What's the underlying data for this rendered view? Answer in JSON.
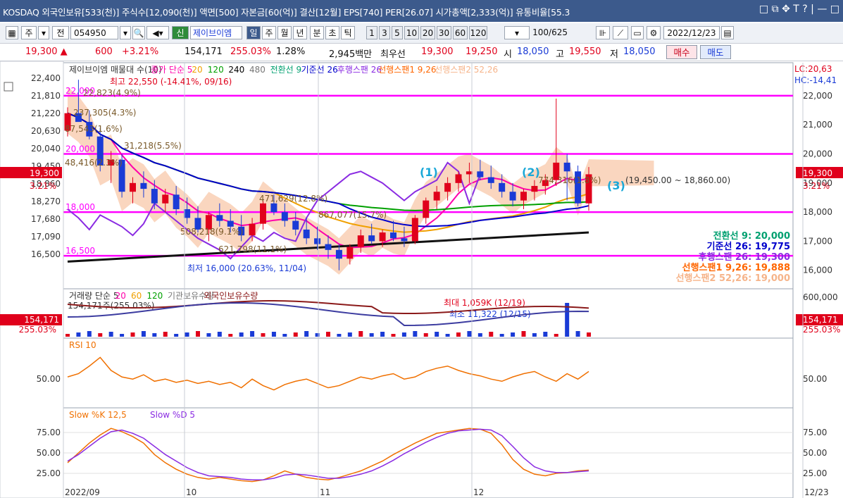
{
  "titlebar": {
    "text": "KOSDAQ 외국인보유[533(천)] 주식수[12,090(천)] 액면[500] 자본금[60(억)] 결산[12월] EPS[740] PER[26.07] 시가총액[2,333(억)] 유통비율[55.3",
    "controls": "□ ⧉ ✥ T ? | — □"
  },
  "toolbar": {
    "period_main": "주",
    "period_prev": "전",
    "code": "054950",
    "stock_name": "제이브이엠",
    "period_day": "일",
    "period_week": "주",
    "period_month": "월",
    "period_year": "년",
    "period_min": "분",
    "period_sec": "초",
    "period_tick": "틱",
    "intervals": [
      "1",
      "3",
      "5",
      "10",
      "20",
      "30",
      "60",
      "120"
    ],
    "count": "100",
    "count_total": "/625",
    "date": "2022/12/23"
  },
  "quote": {
    "price": "19,300",
    "change": "600",
    "change_pct": "+3.21%",
    "volume": "154,171",
    "vol_ratio": "255.03%",
    "turnover": "1.28%",
    "amount": "2,945백만",
    "best_label": "최우선",
    "ask": "19,300",
    "bid": "19,250",
    "open_label": "시",
    "open": "18,050",
    "high_label": "고",
    "high": "19,550",
    "low_label": "저",
    "low": "18,050",
    "buy_label": "매수",
    "sell_label": "매도"
  },
  "chart_data": [
    {
      "type": "candlestick",
      "legend_text": [
        "제이브이엠 매물대 수(10)",
        "종가 단순 5",
        "20",
        "120",
        "240",
        "480",
        "전환선 9",
        "기준선 26",
        "후행스팬 26",
        "선행스팬1 9,26",
        "선행스팬2 52,26"
      ],
      "ylim": [
        15800,
        22700
      ],
      "yticks_left": [
        "22,400",
        "21,810",
        "21,220",
        "20,630",
        "20,040",
        "19,450",
        "18,860",
        "18,270",
        "17,680",
        "17,090",
        "16,500"
      ],
      "yticks_right": [
        "22,000",
        "21,000",
        "20,000",
        "19,000",
        "18,000",
        "17,000",
        "16,000"
      ],
      "top_right": [
        "LC:20,63",
        "HC:-14,41"
      ],
      "current_price": "19,300",
      "current_pct": "3.21%",
      "hlines": [
        {
          "label": "22,000",
          "value": 22000
        },
        {
          "label": "20,000",
          "value": 20000
        },
        {
          "label": "18,000",
          "value": 18000
        },
        {
          "label": "16,500",
          "value": 16500
        }
      ],
      "annotations": [
        "최고 22,550 (-14.41%, 09/16)",
        "최저 16,000 (20.63%, 11/04)",
        "(1)",
        "(2)",
        "(3)",
        "(19,450.00 ~ 18,860.00)"
      ],
      "volume_profile": [
        "237,305(4.3%)",
        "87,543(1.6%)",
        "48,416(2.3%)",
        "471,629(12.8%)",
        "867,077(15.7%)",
        "508,218(9.1%)",
        "621,798(11.1%)",
        "774,316(1.8%)",
        "22,823(4.9%)",
        "31,218(5.5%)"
      ],
      "indicators": [
        {
          "name": "전환선 9",
          "value": "20,000"
        },
        {
          "name": "기준선 26",
          "value": "19,775"
        },
        {
          "name": "후행스팬 26",
          "value": "19,300"
        },
        {
          "name": "선행스팬1 9,26",
          "value": "19,888"
        },
        {
          "name": "선행스팬2 52,26",
          "value": "19,000"
        }
      ],
      "candles": [
        [
          20800,
          21600,
          20600,
          21400
        ],
        [
          21400,
          22550,
          21200,
          21100
        ],
        [
          21100,
          21500,
          20500,
          20600
        ],
        [
          20600,
          20900,
          19400,
          19600
        ],
        [
          19600,
          20100,
          19000,
          19800
        ],
        [
          19800,
          20000,
          18500,
          18700
        ],
        [
          18700,
          19200,
          18300,
          19000
        ],
        [
          19000,
          19400,
          18500,
          18800
        ],
        [
          18800,
          19100,
          18100,
          18300
        ],
        [
          18300,
          18800,
          18000,
          18600
        ],
        [
          18600,
          18900,
          17900,
          18100
        ],
        [
          18100,
          18500,
          17600,
          17800
        ],
        [
          17800,
          18200,
          17300,
          17400
        ],
        [
          17400,
          18000,
          17000,
          17900
        ],
        [
          17900,
          18300,
          17500,
          17700
        ],
        [
          17700,
          18100,
          17300,
          17500
        ],
        [
          17500,
          17900,
          17000,
          17200
        ],
        [
          17200,
          17800,
          17000,
          17600
        ],
        [
          17600,
          18400,
          17400,
          18300
        ],
        [
          18300,
          18600,
          17900,
          18000
        ],
        [
          18000,
          18300,
          17500,
          17700
        ],
        [
          17700,
          18000,
          17200,
          17400
        ],
        [
          17400,
          17800,
          16900,
          17100
        ],
        [
          17100,
          17500,
          16700,
          16900
        ],
        [
          16900,
          17200,
          16400,
          16700
        ],
        [
          16700,
          16900,
          16000,
          16400
        ],
        [
          16400,
          16900,
          16200,
          16800
        ],
        [
          16800,
          17400,
          16600,
          17200
        ],
        [
          17200,
          17600,
          16900,
          17000
        ],
        [
          17000,
          17400,
          16800,
          17300
        ],
        [
          17300,
          17700,
          17000,
          17100
        ],
        [
          17100,
          17500,
          16800,
          17000
        ],
        [
          17000,
          17900,
          16900,
          17800
        ],
        [
          17800,
          18500,
          17600,
          18400
        ],
        [
          18400,
          18900,
          18100,
          18700
        ],
        [
          18700,
          19200,
          18400,
          19000
        ],
        [
          19000,
          19400,
          18700,
          19300
        ],
        [
          19300,
          19700,
          19000,
          19400
        ],
        [
          19400,
          19800,
          19100,
          19200
        ],
        [
          19200,
          19600,
          18800,
          19000
        ],
        [
          19000,
          19300,
          18500,
          18700
        ],
        [
          18700,
          19000,
          18200,
          18400
        ],
        [
          18400,
          18800,
          18100,
          18700
        ],
        [
          18700,
          19100,
          18400,
          18900
        ],
        [
          18900,
          19300,
          18600,
          19100
        ],
        [
          19100,
          21900,
          18900,
          19700
        ],
        [
          19700,
          20000,
          18400,
          19400
        ],
        [
          19400,
          19600,
          18200,
          18300
        ],
        [
          18300,
          19550,
          18050,
          19300
        ]
      ],
      "xlabels": [
        "2022/09",
        "10",
        "11",
        "12",
        "12/23"
      ]
    },
    {
      "type": "bar+line",
      "legend_text": [
        "거래량 단순 5",
        "20",
        "60",
        "120",
        "기관보유수량",
        "외국인보유수량"
      ],
      "current": "154,171주(255.03%)",
      "max_label": "최대 1,059K (12/19)",
      "min_label": "최소 11,322 (12/15)",
      "yticks_right": [
        "600,000"
      ],
      "badge": "154,171",
      "badge_pct": "255.03%"
    },
    {
      "type": "line",
      "legend_text": [
        "RSI 10"
      ],
      "yticks": [
        "50.00"
      ],
      "values": [
        52,
        55,
        62,
        70,
        58,
        52,
        50,
        54,
        48,
        50,
        47,
        49,
        46,
        48,
        45,
        47,
        42,
        50,
        44,
        40,
        45,
        48,
        50,
        46,
        42,
        44,
        48,
        52,
        50,
        53,
        55,
        50,
        52,
        57,
        60,
        62,
        58,
        55,
        53,
        50,
        48,
        52,
        55,
        57,
        52,
        48,
        55,
        50,
        57
      ]
    },
    {
      "type": "line",
      "legend_text": [
        "Slow %K 12,5",
        "Slow %D 5"
      ],
      "yticks": [
        "75.00",
        "50.00",
        "25.00"
      ],
      "k": [
        38,
        50,
        62,
        72,
        80,
        76,
        70,
        62,
        48,
        38,
        30,
        24,
        20,
        18,
        20,
        18,
        16,
        15,
        17,
        22,
        28,
        24,
        20,
        18,
        17,
        20,
        24,
        28,
        34,
        40,
        48,
        55,
        62,
        68,
        74,
        76,
        78,
        80,
        79,
        74,
        60,
        42,
        30,
        24,
        22,
        25,
        26,
        28,
        29
      ],
      "d": [
        40,
        48,
        58,
        68,
        76,
        78,
        74,
        68,
        58,
        48,
        40,
        32,
        26,
        22,
        21,
        20,
        18,
        17,
        17,
        19,
        23,
        24,
        23,
        21,
        19,
        19,
        21,
        24,
        28,
        34,
        41,
        49,
        56,
        63,
        69,
        74,
        77,
        78,
        79,
        78,
        71,
        58,
        44,
        33,
        28,
        26,
        26,
        27,
        28
      ]
    }
  ]
}
